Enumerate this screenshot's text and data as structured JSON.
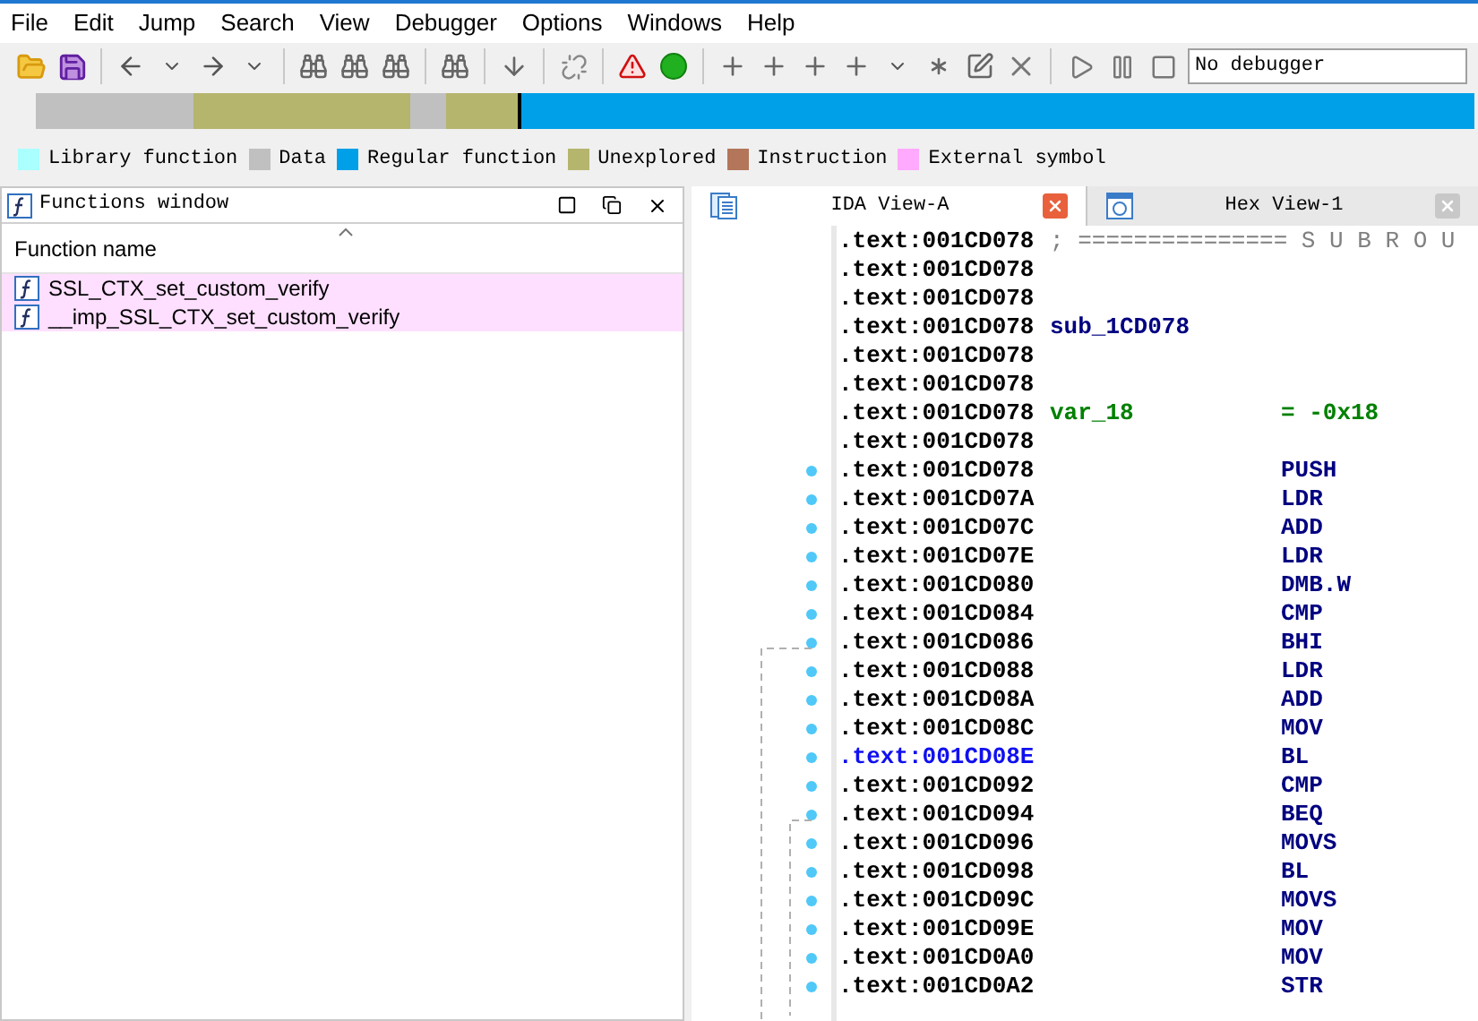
{
  "menu": [
    "File",
    "Edit",
    "Jump",
    "Search",
    "View",
    "Debugger",
    "Options",
    "Windows",
    "Help"
  ],
  "toolbar": {
    "debugger_select": "No debugger"
  },
  "legend": [
    {
      "label": "Library function",
      "color": "#aaffff"
    },
    {
      "label": "Data",
      "color": "#c0c0c0"
    },
    {
      "label": "Regular function",
      "color": "#00a0e8"
    },
    {
      "label": "Unexplored",
      "color": "#b5b56e"
    },
    {
      "label": "Instruction",
      "color": "#b4765a"
    },
    {
      "label": "External symbol",
      "color": "#ffaaff"
    }
  ],
  "functions_window": {
    "title": "Functions window",
    "column": "Function name",
    "rows": [
      "SSL_CTX_set_custom_verify",
      "__imp_SSL_CTX_set_custom_verify"
    ]
  },
  "tabs": [
    {
      "label": "IDA View-A",
      "selected": true,
      "kind": "disasm"
    },
    {
      "label": "Hex View-1",
      "selected": false,
      "kind": "hex"
    }
  ],
  "code": [
    {
      "kind": "comment",
      "address": ".text:001CD078",
      "text": "; =============== S U B R O U"
    },
    {
      "kind": "blank",
      "address": ".text:001CD078"
    },
    {
      "kind": "blank",
      "address": ".text:001CD078"
    },
    {
      "kind": "label",
      "address": ".text:001CD078",
      "text": "sub_1CD078"
    },
    {
      "kind": "blank",
      "address": ".text:001CD078"
    },
    {
      "kind": "blank",
      "address": ".text:001CD078"
    },
    {
      "kind": "var",
      "address": ".text:001CD078",
      "text": "var_18",
      "value": "= -0x18"
    },
    {
      "kind": "blank",
      "address": ".text:001CD078"
    },
    {
      "kind": "instr",
      "address": ".text:001CD078",
      "text": "PUSH"
    },
    {
      "kind": "instr",
      "address": ".text:001CD07A",
      "text": "LDR"
    },
    {
      "kind": "instr",
      "address": ".text:001CD07C",
      "text": "ADD"
    },
    {
      "kind": "instr",
      "address": ".text:001CD07E",
      "text": "LDR"
    },
    {
      "kind": "instr",
      "address": ".text:001CD080",
      "text": "DMB.W"
    },
    {
      "kind": "instr",
      "address": ".text:001CD084",
      "text": "CMP"
    },
    {
      "kind": "instr",
      "address": ".text:001CD086",
      "text": "BHI"
    },
    {
      "kind": "instr",
      "address": ".text:001CD088",
      "text": "LDR"
    },
    {
      "kind": "instr",
      "address": ".text:001CD08A",
      "text": "ADD"
    },
    {
      "kind": "instr",
      "address": ".text:001CD08C",
      "text": "MOV"
    },
    {
      "kind": "instr",
      "address": ".text:001CD08E",
      "text": "BL",
      "selected": true
    },
    {
      "kind": "instr",
      "address": ".text:001CD092",
      "text": "CMP"
    },
    {
      "kind": "instr",
      "address": ".text:001CD094",
      "text": "BEQ"
    },
    {
      "kind": "instr",
      "address": ".text:001CD096",
      "text": "MOVS"
    },
    {
      "kind": "instr",
      "address": ".text:001CD098",
      "text": "BL"
    },
    {
      "kind": "instr",
      "address": ".text:001CD09C",
      "text": "MOVS"
    },
    {
      "kind": "instr",
      "address": ".text:001CD09E",
      "text": "MOV"
    },
    {
      "kind": "instr",
      "address": ".text:001CD0A0",
      "text": "MOV"
    },
    {
      "kind": "instr",
      "address": ".text:001CD0A2",
      "text": "STR"
    }
  ]
}
